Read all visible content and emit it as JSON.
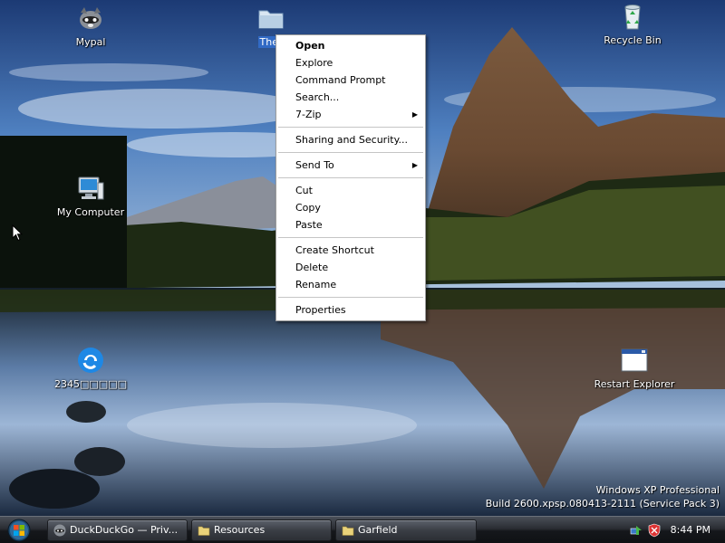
{
  "desktop": {
    "icons": [
      {
        "label": "Mypal",
        "icon": "raccoon-app-icon"
      },
      {
        "label": "Ther",
        "icon": "folder-icon",
        "selected": true
      },
      {
        "label": "Recycle Bin",
        "icon": "recycle-bin-icon"
      },
      {
        "label": "My Computer",
        "icon": "computer-icon"
      },
      {
        "label": "2345□□□□□",
        "icon": "ie-browser-icon"
      },
      {
        "label": "Restart Explorer",
        "icon": "window-app-icon"
      }
    ]
  },
  "context_menu": {
    "items": [
      {
        "label": "Open",
        "bold": true
      },
      {
        "label": "Explore"
      },
      {
        "label": "Command Prompt"
      },
      {
        "label": "Search..."
      },
      {
        "label": "7-Zip",
        "submenu": true
      },
      {
        "label": "Sharing and Security..."
      },
      {
        "label": "Send To",
        "submenu": true
      },
      {
        "label": "Cut"
      },
      {
        "label": "Copy"
      },
      {
        "label": "Paste"
      },
      {
        "label": "Create Shortcut"
      },
      {
        "label": "Delete"
      },
      {
        "label": "Rename"
      },
      {
        "label": "Properties"
      }
    ]
  },
  "watermark": {
    "line1": "Windows XP Professional",
    "line2": "Build 2600.xpsp.080413-2111 (Service Pack 3)"
  },
  "taskbar": {
    "buttons": [
      {
        "label": "DuckDuckGo — Priv...",
        "icon": "duckduckgo-icon"
      },
      {
        "label": "Resources",
        "icon": "folder-icon"
      },
      {
        "label": "Garfield",
        "icon": "folder-icon"
      }
    ],
    "clock": "8:44 PM"
  },
  "colors": {
    "selection": "#316ac5",
    "menu_bg": "#ffffff",
    "taskbar": "#2a2d33"
  }
}
